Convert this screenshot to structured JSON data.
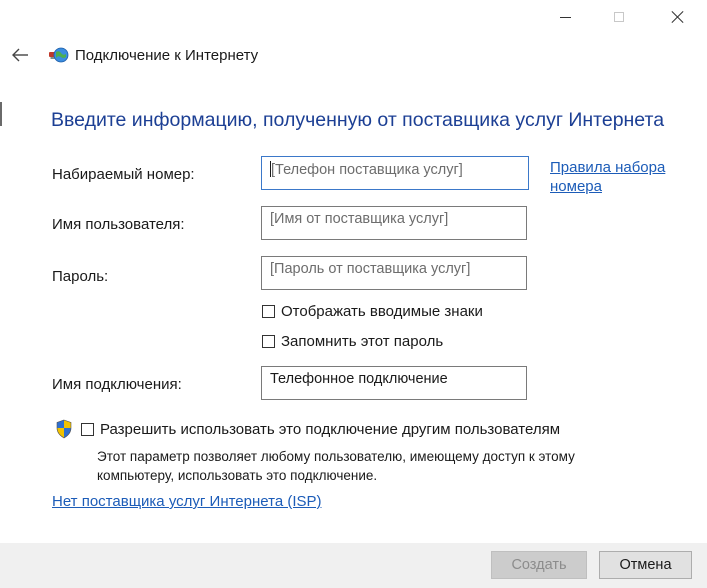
{
  "window": {
    "title": "Подключение к Интернету",
    "controls": [
      "minimize-icon",
      "maximize-icon",
      "close-icon"
    ]
  },
  "wizard": {
    "heading": "Введите информацию, полученную от поставщика услуг Интернета",
    "fields": {
      "phone": {
        "label": "Набираемый номер:",
        "placeholder": "[Телефон поставщика услуг]",
        "value": ""
      },
      "username": {
        "label": "Имя пользователя:",
        "placeholder": "[Имя от поставщика услуг]",
        "value": ""
      },
      "password": {
        "label": "Пароль:",
        "placeholder": "[Пароль от поставщика услуг]",
        "value": ""
      },
      "connection_name": {
        "label": "Имя подключения:",
        "placeholder": "",
        "value": "Телефонное подключение"
      }
    },
    "dialing_rules_link": [
      "Правила набора",
      "номера"
    ],
    "checkboxes": {
      "show_chars": {
        "label": "Отображать вводимые знаки",
        "checked": false
      },
      "remember_password": {
        "label": "Запомнить этот пароль",
        "checked": false
      },
      "allow_others": {
        "label": "Разрешить использовать это подключение другим пользователям",
        "checked": false
      }
    },
    "allow_others_note": [
      "Этот параметр позволяет любому пользователю, имеющему доступ к этому",
      "компьютеру, использовать это подключение."
    ],
    "no_isp_link": "Нет поставщика услуг Интернета (ISP)"
  },
  "buttons": {
    "create": {
      "label": "Создать",
      "enabled": false
    },
    "cancel": {
      "label": "Отмена",
      "enabled": true
    }
  },
  "colors": {
    "heading": "#1c3f94",
    "link": "#1c5cb8",
    "focus_border": "#3b78c9",
    "footer": "#f0f0f0"
  }
}
